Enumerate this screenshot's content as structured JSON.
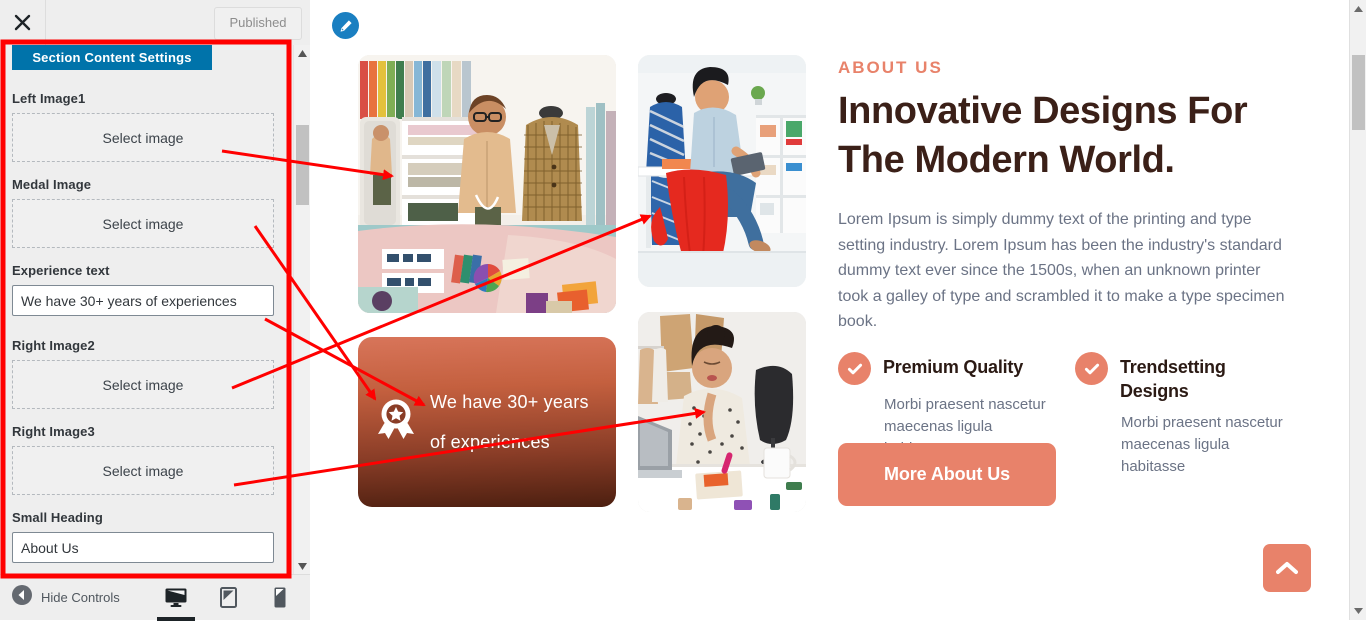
{
  "customizer": {
    "close_icon": "close-x-icon",
    "publish_label": "Published",
    "section_title": "Section Content Settings",
    "fields": [
      {
        "label": "Left Image1",
        "type": "image",
        "value": "Select image"
      },
      {
        "label": "Medal Image",
        "type": "image",
        "value": "Select image"
      },
      {
        "label": "Experience text",
        "type": "text",
        "value": "We have 30+ years of experiences"
      },
      {
        "label": "Right Image2",
        "type": "image",
        "value": "Select image"
      },
      {
        "label": "Right Image3",
        "type": "image",
        "value": "Select image"
      },
      {
        "label": "Small Heading",
        "type": "text",
        "value": "About Us"
      }
    ],
    "footer": {
      "hide_controls_label": "Hide Controls",
      "devices": [
        {
          "name": "desktop",
          "active": true
        },
        {
          "name": "tablet",
          "active": false
        },
        {
          "name": "mobile",
          "active": false
        }
      ]
    }
  },
  "preview": {
    "edit_icon": "pencil-edit-icon",
    "images": [
      {
        "name": "left-image1",
        "alt": "Fashion designer working at studio table with fabrics"
      },
      {
        "name": "right-image2",
        "alt": "Designer sitting on table with red fabric and mannequin"
      },
      {
        "name": "right-image3",
        "alt": "Woman at desk with laptop, notebook and mannequin"
      }
    ],
    "experience_card": {
      "icon": "medal-award-icon",
      "text": "We have 30+ years of experiences"
    },
    "eyebrow": "ABOUT US",
    "headline": "Innovative Designs For The Modern World.",
    "body": "Lorem Ipsum is simply dummy text of the printing and type setting industry. Lorem Ipsum has been the industry's standard dummy text ever since the 1500s, when an unknown printer took a galley of type and scrambled it to make a type specimen book.",
    "features": [
      {
        "icon": "check-circle-icon",
        "title": "Premium Quality",
        "desc": "Morbi praesent nascetur maecenas ligula habitasse"
      },
      {
        "icon": "check-circle-icon",
        "title": "Trendsetting Designs",
        "desc": "Morbi praesent nascetur maecenas ligula habitasse"
      }
    ],
    "cta_label": "More About Us",
    "scroll_top_icon": "chevron-up-icon"
  },
  "colors": {
    "accent": "#e8826a",
    "heading": "#3b2018",
    "body_text": "#6b7385",
    "panel_header": "#0073aa",
    "annotation": "#ff0000",
    "edit_button": "#1a7fc1"
  }
}
